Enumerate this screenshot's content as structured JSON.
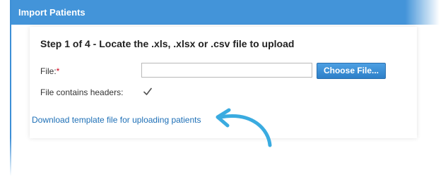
{
  "dialog": {
    "title": "Import Patients",
    "step_heading": "Step 1 of 4 - Locate the .xls, .xlsx or .csv file to upload",
    "file_label": "File:",
    "required_marker": "*",
    "file_value": "",
    "choose_button_label": "Choose File...",
    "headers_label": "File contains headers:",
    "headers_checked": true,
    "template_link_label": "Download template file for uploading patients"
  },
  "colors": {
    "title_bar": "#4394d9",
    "button": "#2d7fc8",
    "link": "#1d6fb6",
    "required": "#d0021b",
    "annotation_arrow": "#3aabe0"
  },
  "icons": {
    "checkbox": "checkmark-icon",
    "annotation": "curved-arrow-icon"
  }
}
